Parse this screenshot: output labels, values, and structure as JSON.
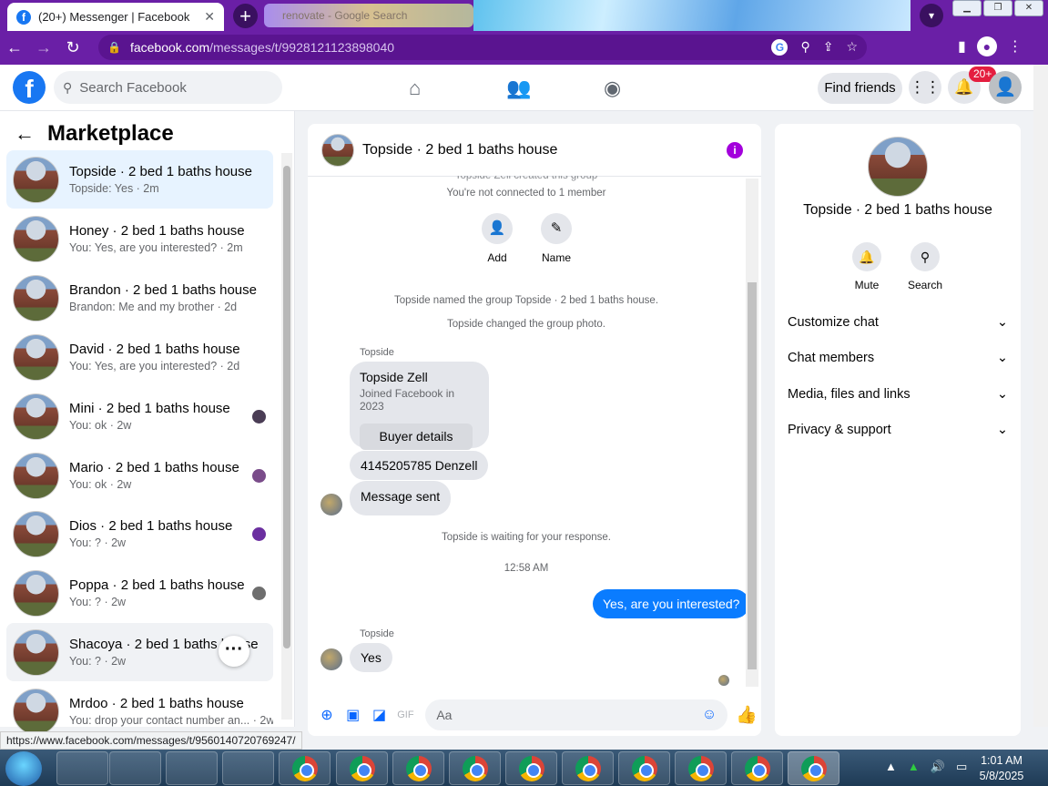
{
  "browser": {
    "tab_title": "(20+) Messenger | Facebook",
    "tab_close": "✕",
    "new_tab": "+",
    "ghost_tab_title": "renovate - Google Search",
    "url_domain": "facebook.com",
    "url_path": "/messages/t/9928121123898040",
    "status_url": "https://www.facebook.com/messages/t/9560140720769247/"
  },
  "fb_header": {
    "search_placeholder": "Search Facebook",
    "find_friends": "Find friends",
    "notif_badge": "20+"
  },
  "left": {
    "title": "Marketplace",
    "conversations": [
      {
        "name": "Topside · 2 bed 1 baths house",
        "preview": "Topside: Yes · 2m"
      },
      {
        "name": "Honey · 2 bed 1 baths house",
        "preview": "You: Yes, are you interested? · 2m"
      },
      {
        "name": "Brandon · 2 bed 1 baths house",
        "preview": "Brandon: Me and my brother · 2d"
      },
      {
        "name": "David · 2 bed 1 baths house",
        "preview": "You: Yes, are you interested? · 2d"
      },
      {
        "name": "Mini · 2 bed 1 baths house",
        "preview": "You: ok · 2w"
      },
      {
        "name": "Mario · 2 bed 1 baths house",
        "preview": "You: ok · 2w"
      },
      {
        "name": "Dios · 2 bed 1 baths house",
        "preview": "You: ? · 2w"
      },
      {
        "name": "Poppa · 2 bed 1 baths house",
        "preview": "You: ? · 2w"
      },
      {
        "name": "Shacoya · 2 bed 1 baths house",
        "preview": "You: ? · 2w"
      },
      {
        "name": "Mrdoo · 2 bed 1 baths house",
        "preview": "You: drop your contact number an... · 2w"
      }
    ]
  },
  "chat": {
    "title": "Topside · 2 bed 1 baths house",
    "sys_created": "Topside Zell created this group",
    "sys_not_connected": "You're not connected to 1 member",
    "action_add": "Add",
    "action_name": "Name",
    "sys_named": "Topside named the group Topside · 2 bed 1 baths house.",
    "sys_photo": "Topside changed the group photo.",
    "sender1": "Topside",
    "card_name": "Topside Zell",
    "card_sub": "Joined Facebook in 2023",
    "card_button": "Buyer details",
    "msg_phone": "4145205785 Denzell",
    "msg_sent": "Message sent",
    "sys_waiting": "Topside is waiting for your response.",
    "time": "12:58 AM",
    "out_msg": "Yes, are you interested?",
    "sender2": "Topside",
    "msg_yes": "Yes",
    "composer_placeholder": "Aa"
  },
  "right": {
    "title": "Topside · 2 bed 1 baths house",
    "mute": "Mute",
    "search": "Search",
    "rows": [
      "Customize chat",
      "Chat members",
      "Media, files and links",
      "Privacy & support"
    ]
  },
  "taskbar": {
    "time": "1:01 AM",
    "date": "5/8/2025"
  }
}
